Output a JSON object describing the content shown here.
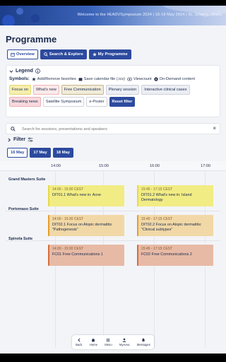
{
  "banner": {
    "text": "Welcome to the #EADVSymposium 2024 | 16-18 May 2024 | St. Julian's - Malta"
  },
  "page": {
    "title": "Programme"
  },
  "top_tabs": [
    {
      "label": "Overview",
      "icon": "calendar-icon"
    },
    {
      "label": "Search & Explore",
      "icon": "search-icon"
    },
    {
      "label": "My Programme",
      "icon": "star-icon"
    }
  ],
  "legend": {
    "title": "Legend",
    "symbols_label": "Symbols:",
    "symbols": [
      {
        "label": "Add/Remove favorites",
        "icon": "star-icon"
      },
      {
        "label": "Save calendar file (.ics)",
        "icon": "calendar-icon"
      },
      {
        "label": "Viewcount",
        "icon": "eye-icon"
      },
      {
        "label": "On-Demand content",
        "icon": "play-icon"
      }
    ],
    "chips": [
      {
        "label": "Focus on",
        "kind": "focus"
      },
      {
        "label": "What's new",
        "kind": "new"
      },
      {
        "label": "Free Communication",
        "kind": "free"
      },
      {
        "label": "Plenary session",
        "kind": "plenary"
      },
      {
        "label": "Interactive clinical cases",
        "kind": "clinical"
      },
      {
        "label": "Breaking news",
        "kind": "breaking"
      },
      {
        "label": "Satellite Symposium",
        "kind": "sat"
      },
      {
        "label": "e-Poster",
        "kind": "eposter"
      },
      {
        "label": "Reset filter",
        "kind": "reset"
      }
    ]
  },
  "search": {
    "placeholder": "Search for sessions, presentations and speakers",
    "value": ""
  },
  "filter": {
    "label": "Filter"
  },
  "days": [
    {
      "label": "16 May",
      "active": false
    },
    {
      "label": "17 May",
      "active": true
    },
    {
      "label": "18 May",
      "active": true
    }
  ],
  "timeline": {
    "hours": [
      "14:00",
      "15:00",
      "16:00",
      "17:00"
    ],
    "rooms": [
      {
        "name": "Grand Masters Suite",
        "sessions": [
          {
            "time": "14:00 - 15:30 CEST",
            "title": "DIT01.1 What's new in: Acne",
            "color": "yellow"
          },
          {
            "time": "15:45 - 17:15 CEST",
            "title": "DIT01.2 What's new in: Island Dermatology",
            "color": "yellow"
          }
        ]
      },
      {
        "name": "Portomaso Suite",
        "sessions": [
          {
            "time": "14:00 - 15:30 CEST",
            "title": "DIT02.1 Focus on Atopic dermatitis: \"Pathogenesis\"",
            "color": "orange"
          },
          {
            "time": "15:45 - 17:15 CEST",
            "title": "DIT02.2 Focus on Atopic dermatitis: \"Clinical subtypes\"",
            "color": "orange"
          }
        ]
      },
      {
        "name": "Spinola Suite",
        "sessions": [
          {
            "time": "14:00 - 15:30 CEST",
            "title": "FC01 Free Communications 1",
            "color": "salmon"
          },
          {
            "time": "15:45 - 17:15 CEST",
            "title": "FC02 Free Communications 2",
            "color": "salmon"
          }
        ]
      }
    ]
  },
  "nav": [
    {
      "label": "Back",
      "icon": "back-icon"
    },
    {
      "label": "Home",
      "icon": "home-icon"
    },
    {
      "label": "Menu",
      "icon": "menu-icon"
    },
    {
      "label": "MyArea",
      "icon": "user-icon"
    },
    {
      "label": "Messages",
      "icon": "bell-icon"
    }
  ],
  "colors": {
    "accent": "#2c4a9e",
    "session_yellow": "#f2ec84",
    "session_orange": "#f1d8a6",
    "session_salmon": "#e7baa6"
  }
}
